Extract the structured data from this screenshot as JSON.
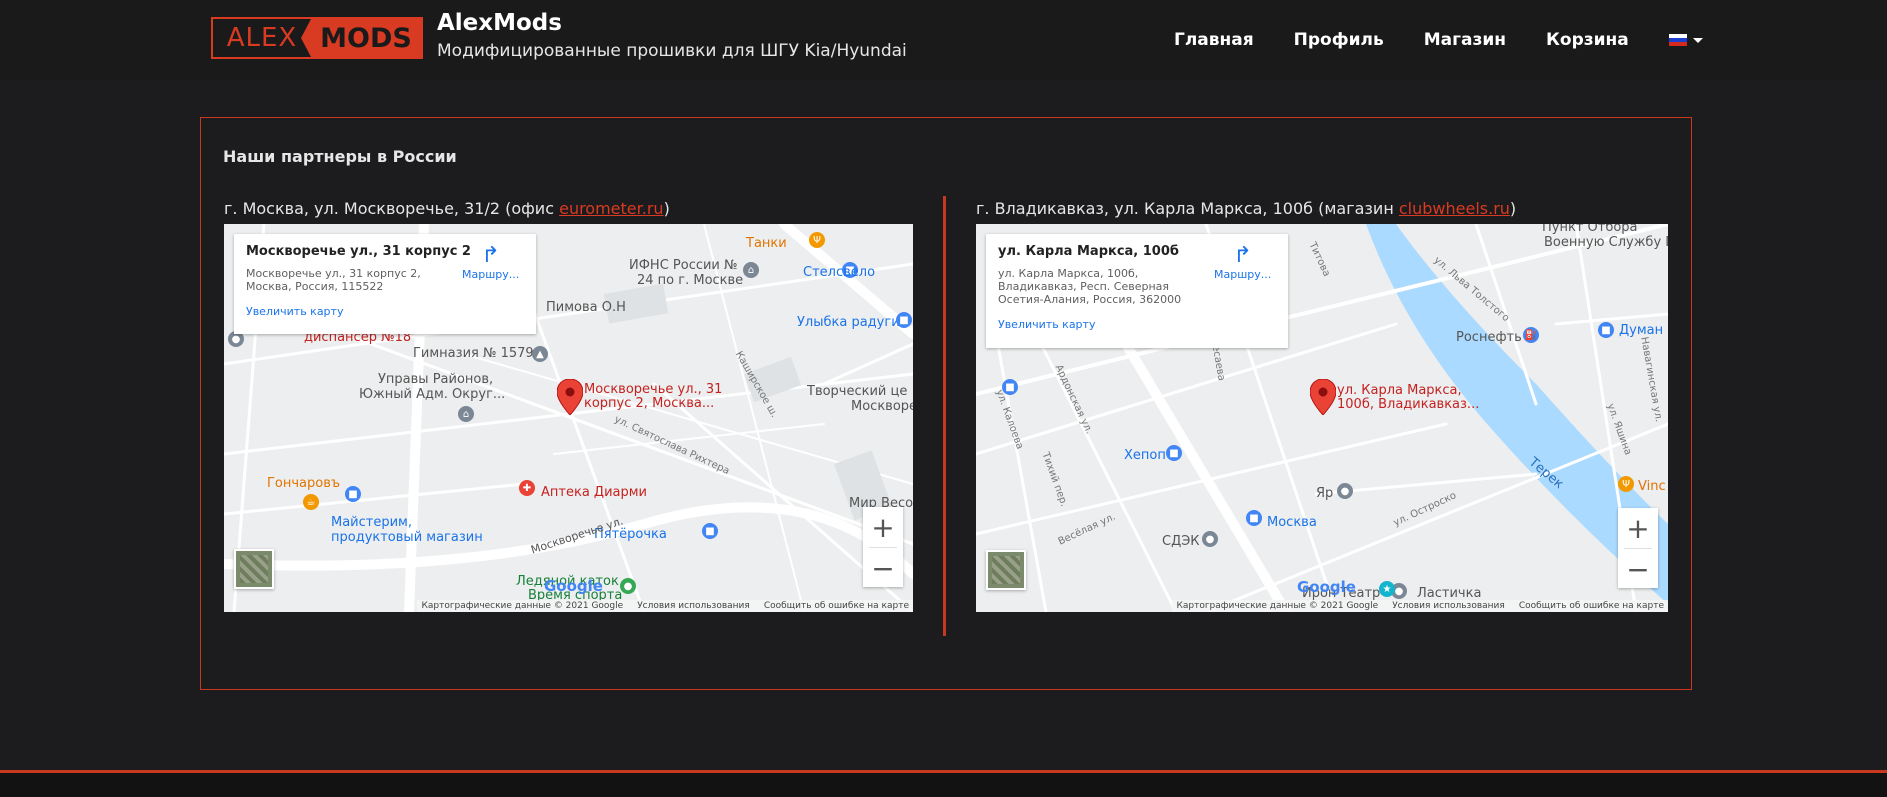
{
  "header": {
    "logo_left": "ALEX",
    "logo_right": "MODS",
    "title": "AlexMods",
    "subtitle": "Модифицированные прошивки для ШГУ Kia/Hyundai",
    "nav": [
      {
        "label": "Главная"
      },
      {
        "label": "Профиль"
      },
      {
        "label": "Магазин"
      },
      {
        "label": "Корзина"
      }
    ],
    "language_flag_colors": [
      "#ffffff",
      "#1c3fd0",
      "#d52b1e"
    ]
  },
  "section": {
    "title": "Наши партнеры в России"
  },
  "partners": [
    {
      "caption_prefix": "г. Москва, ул. Москворечье, 31/2 (офис ",
      "link_text": "eurometer.ru",
      "caption_suffix": ")",
      "map": {
        "info_title": "Москворечье ул., 31 корпус 2",
        "info_addr_1": "Москворечье ул., 31 корпус 2,",
        "info_addr_2": "Москва, Россия, 115522",
        "info_addr_3": "",
        "info_zoom": "Увеличить карту",
        "route_label": "Маршру...",
        "pin_line_1": "Москворечье ул., 31",
        "pin_line_2": "корпус 2, Москва...",
        "labels": [
          "Танки",
          "ИФНС России №",
          "24 по г. Москве",
          "Стелсвело",
          "Улыбка радуги",
          "Пимова О.Н",
          "диспансер №18",
          "Гимназия № 1579",
          "Управы Районов,",
          "Южный Адм. Округ...",
          "Творческий це",
          "Москворе",
          "Гончаровъ",
          "Аптека Диарми",
          "Майстерим,",
          "продуктовый магазин",
          "Пятёрочка",
          "Мир Весо",
          "Москворечье ул.",
          "Каширское ш.",
          "ул. Святослава Рихтера",
          "Ледяной каток",
          "Время спорта"
        ],
        "attrib": [
          "Картографические данные © 2021 Google",
          "Условия использования",
          "Сообщить об ошибке на карте"
        ],
        "google": "Google"
      }
    },
    {
      "caption_prefix": "г. Владикавказ, ул. Карла Маркса, 100б (магазин ",
      "link_text": "clubwheels.ru",
      "caption_suffix": ")",
      "map": {
        "info_title": "ул. Карла Маркса, 100б",
        "info_addr_1": "ул. Карла Маркса, 100б,",
        "info_addr_2": "Владикавказ, Респ. Северная",
        "info_addr_3": "Осетия-Алания, Россия, 362000",
        "info_zoom": "Увеличить карту",
        "route_label": "Маршру...",
        "pin_line_1": "ул. Карла Маркса,",
        "pin_line_2": "100б, Владикавказ...",
        "labels": [
          "Пункт Отбора",
          "Военную Службу П",
          "Роснефть",
          "Думан",
          "Хепоп",
          "Москва",
          "СДЭК",
          "Яр",
          "Терек",
          "Vinc",
          "Ластичка",
          "Ирон Театр",
          "ул. Льва Толстого",
          "Титова",
          "ул. Остроско",
          "Ардонская ул.",
          "Тихий пер.",
          "Весёлая ул.",
          "ул. Калоева",
          "ул. Яшина",
          "Кесаева",
          "Навагинская ул.",
          "Ирон Театр",
          "ул. Островского",
          "ул. Тогоева"
        ],
        "attrib": [
          "Картографические данные © 2021 Google",
          "Условия использования",
          "Сообщить об ошибке на карте"
        ],
        "google": "Google"
      }
    }
  ]
}
